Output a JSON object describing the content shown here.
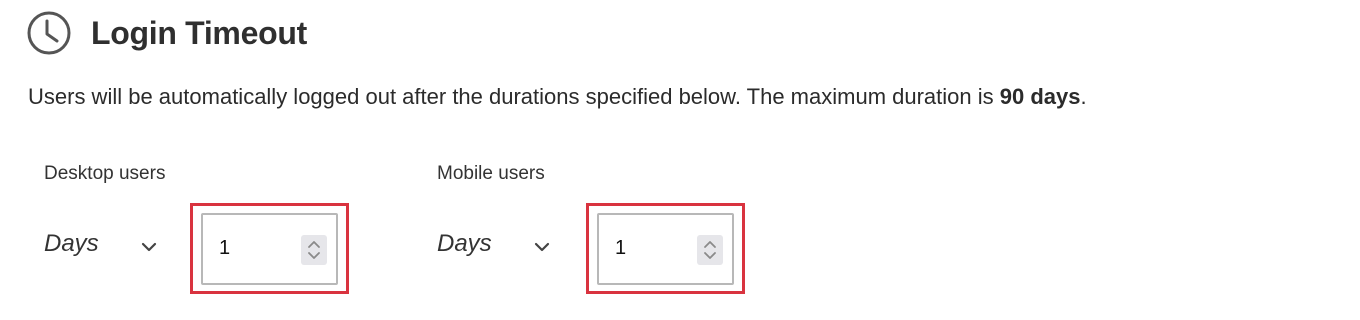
{
  "header": {
    "title": "Login Timeout",
    "icon": "clock-icon"
  },
  "description": {
    "text": "Users will be automatically logged out after the durations specified below. The maximum duration is ",
    "max_duration": "90 days",
    "suffix": "."
  },
  "desktop": {
    "label": "Desktop users",
    "unit": "Days",
    "value": "1"
  },
  "mobile": {
    "label": "Mobile users",
    "unit": "Days",
    "value": "1"
  },
  "colors": {
    "highlight": "#d9333f",
    "stepper_bg": "#e6e6ea"
  }
}
